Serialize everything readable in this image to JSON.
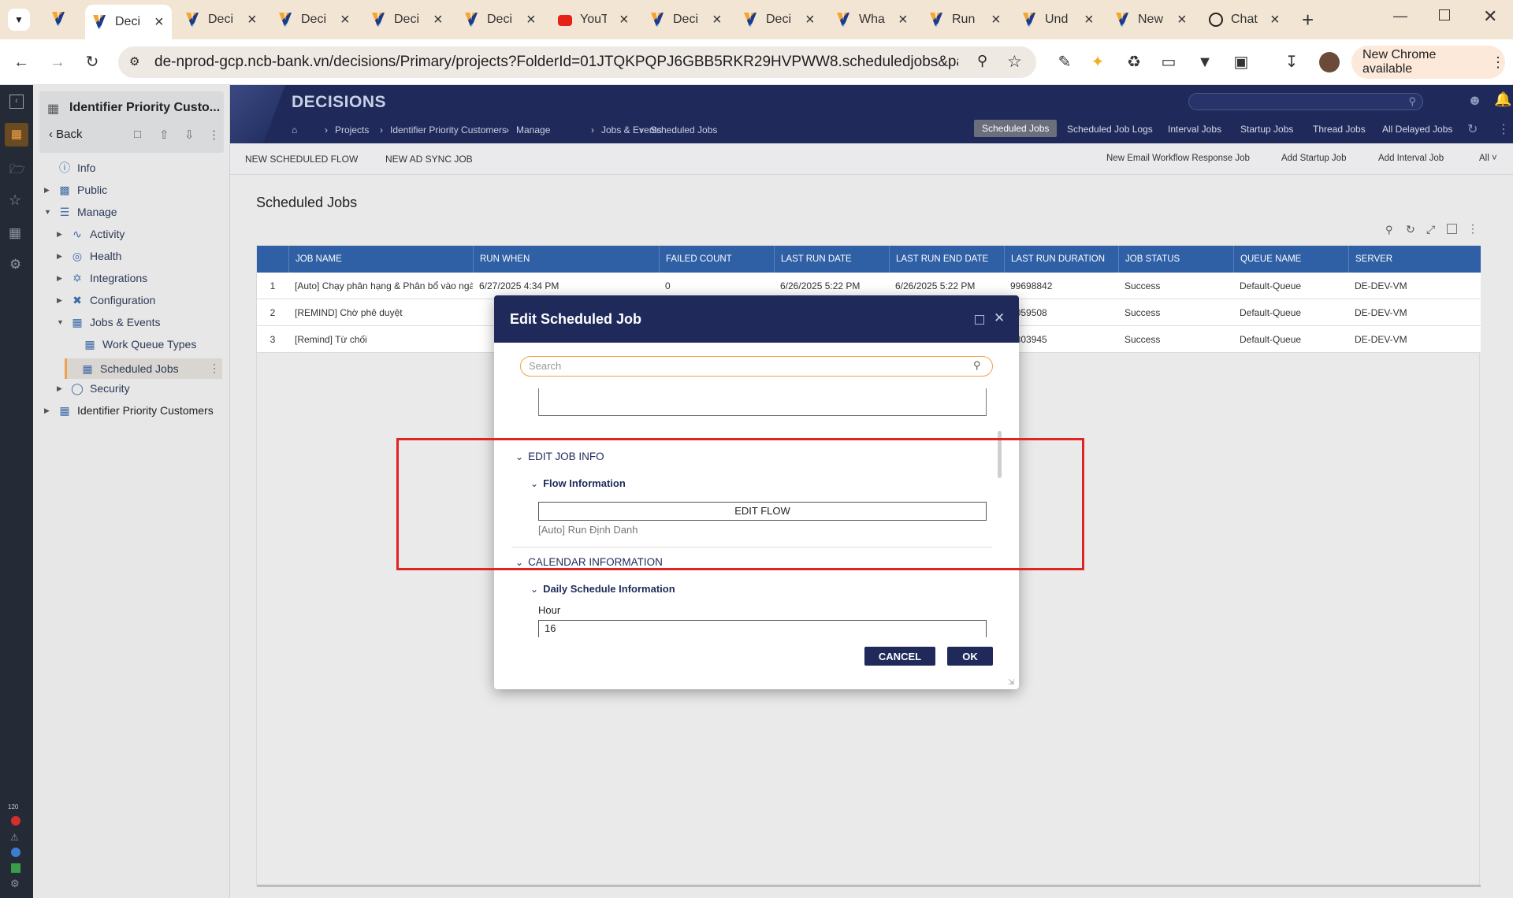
{
  "browser": {
    "tabs": [
      {
        "title": "Deci",
        "icon": "decisions-favicon",
        "active": true
      },
      {
        "title": "Deci",
        "icon": "decisions-favicon"
      },
      {
        "title": "Deci",
        "icon": "decisions-favicon"
      },
      {
        "title": "Deci",
        "icon": "decisions-favicon"
      },
      {
        "title": "Deci",
        "icon": "decisions-favicon"
      },
      {
        "title": "YouT",
        "icon": "youtube-favicon"
      },
      {
        "title": "Deci",
        "icon": "decisions-favicon"
      },
      {
        "title": "Deci",
        "icon": "decisions-favicon"
      },
      {
        "title": "Wha",
        "icon": "decisions-favicon"
      },
      {
        "title": "Run",
        "icon": "decisions-favicon"
      },
      {
        "title": "Und",
        "icon": "decisions-favicon"
      },
      {
        "title": "New",
        "icon": "decisions-favicon"
      },
      {
        "title": "Chat",
        "icon": "chatgpt-favicon"
      }
    ],
    "url": "de-nprod-gcp.ncb-bank.vn/decisions/Primary/projects?FolderId=01JTQKPQPJ6GBB5RKR29HVPWW8.scheduledjobs&pageName=S...",
    "new_chrome_label": "New Chrome available"
  },
  "app": {
    "brand": "DECISIONS",
    "project_title": "Identifier Priority Custo...",
    "back_label": "Back",
    "breadcrumbs": [
      "Projects",
      "Identifier Priority Customers",
      "Manage",
      "Jobs & Events",
      "Scheduled Jobs"
    ],
    "nav_links": [
      "Scheduled Jobs",
      "Scheduled Job Logs",
      "Interval Jobs",
      "Startup Jobs",
      "Thread Jobs",
      "All Delayed Jobs"
    ],
    "actions_left": [
      "NEW SCHEDULED FLOW",
      "NEW AD SYNC JOB"
    ],
    "actions_right": [
      "New Email Workflow Response Job",
      "Add Startup Job",
      "Add Interval Job",
      "All"
    ],
    "tree": {
      "info": "Info",
      "public": "Public",
      "manage": "Manage",
      "activity": "Activity",
      "health": "Health",
      "integrations": "Integrations",
      "configuration": "Configuration",
      "jobs_events": "Jobs & Events",
      "work_queue_types": "Work Queue Types",
      "scheduled_jobs": "Scheduled Jobs",
      "security": "Security",
      "identifier": "Identifier Priority Customers"
    },
    "page_title": "Scheduled Jobs",
    "rail_badge": "120"
  },
  "table": {
    "columns": [
      "JOB NAME",
      "RUN WHEN",
      "FAILED COUNT",
      "LAST RUN DATE",
      "LAST RUN END DATE",
      "LAST RUN DURATION",
      "JOB STATUS",
      "QUEUE NAME",
      "SERVER"
    ],
    "rows": [
      {
        "num": "1",
        "name": "[Auto] Chạy phân hạng & Phân bổ vào ngà...",
        "run_when": "6/27/2025 4:34 PM",
        "failed": "0",
        "last_run": "6/26/2025 5:22 PM",
        "last_end": "6/26/2025 5:22 PM",
        "duration": "99698842",
        "status": "Success",
        "queue": "Default-Queue",
        "server": "DE-DEV-VM"
      },
      {
        "num": "2",
        "name": "[REMIND] Chờ phê duyệt",
        "run_when": "",
        "failed": "",
        "last_run": "",
        "last_end": "",
        "duration": "5059508",
        "status": "Success",
        "queue": "Default-Queue",
        "server": "DE-DEV-VM"
      },
      {
        "num": "3",
        "name": "[Remind] Từ chối",
        "run_when": "",
        "failed": "",
        "last_run": "",
        "last_end": "",
        "duration": "8803945",
        "status": "Success",
        "queue": "Default-Queue",
        "server": "DE-DEV-VM"
      }
    ]
  },
  "modal": {
    "title": "Edit Scheduled Job",
    "search_placeholder": "Search",
    "edit_job_info": "EDIT JOB INFO",
    "flow_information": "Flow Information",
    "edit_flow": "EDIT FLOW",
    "flow_name": "[Auto] Run Định Danh",
    "calendar_information": "CALENDAR INFORMATION",
    "daily_schedule": "Daily Schedule Information",
    "hour_label": "Hour",
    "hour_value": "16",
    "cancel": "CANCEL",
    "ok": "OK"
  },
  "colors": {
    "brand_navy": "#1f2a5b",
    "table_header": "#2f5fa5",
    "highlight": "#e02424",
    "search_border": "#f0a24a"
  }
}
